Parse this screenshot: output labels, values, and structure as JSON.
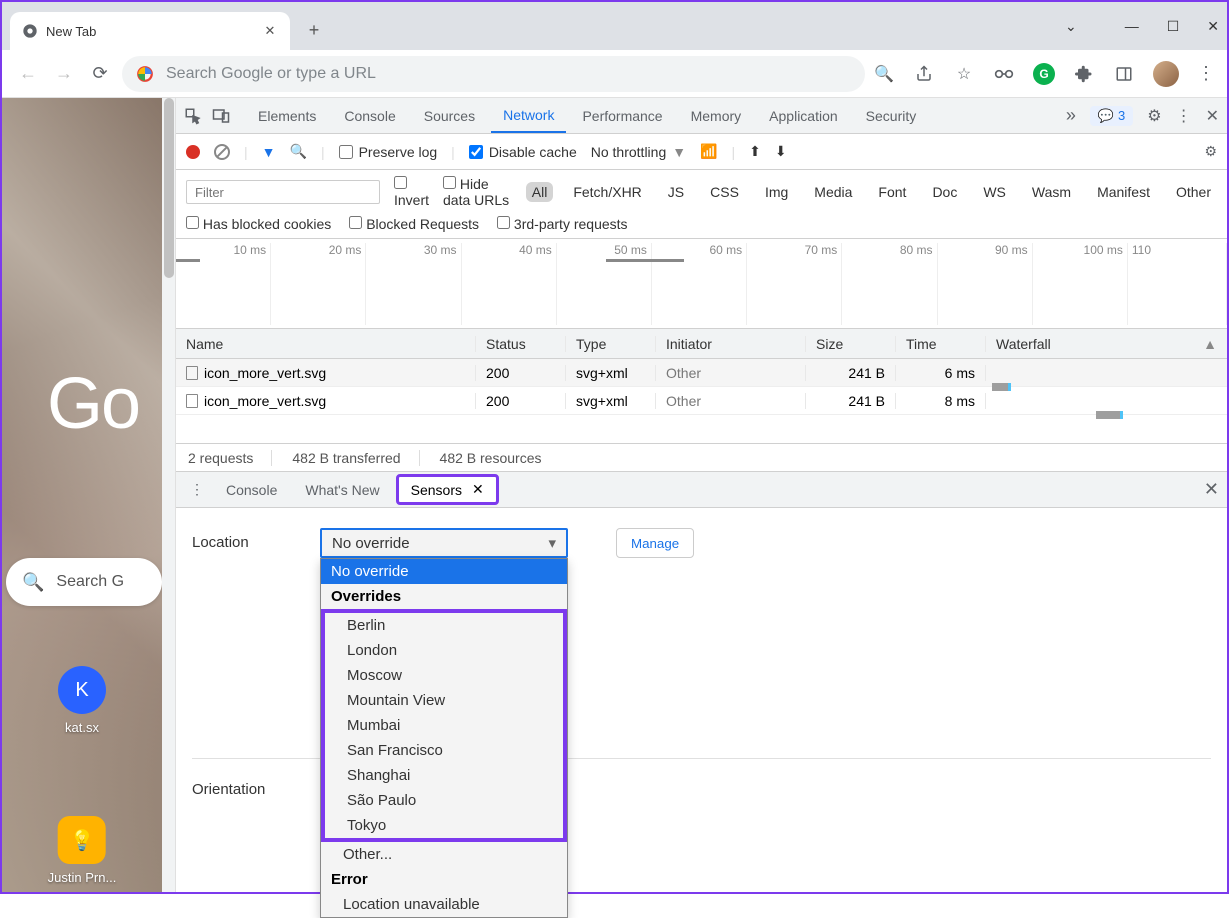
{
  "browser": {
    "tab_title": "New Tab",
    "omnibox_placeholder": "Search Google or type a URL"
  },
  "page": {
    "logo_text": "Go",
    "search_placeholder": "Search G",
    "shortcuts": [
      {
        "letter": "K",
        "label": "kat.sx"
      },
      {
        "letter": "",
        "label": "Justin Prn..."
      }
    ]
  },
  "devtools": {
    "tabs": [
      "Elements",
      "Console",
      "Sources",
      "Network",
      "Performance",
      "Memory",
      "Application",
      "Security"
    ],
    "active_tab": "Network",
    "issues_count": "3",
    "network_toolbar": {
      "preserve_log": "Preserve log",
      "disable_cache": "Disable cache",
      "throttling": "No throttling"
    },
    "filter": {
      "placeholder": "Filter",
      "invert": "Invert",
      "hide_data_urls": "Hide data URLs",
      "types": [
        "All",
        "Fetch/XHR",
        "JS",
        "CSS",
        "Img",
        "Media",
        "Font",
        "Doc",
        "WS",
        "Wasm",
        "Manifest",
        "Other"
      ],
      "active_type": "All",
      "has_blocked_cookies": "Has blocked cookies",
      "blocked_requests": "Blocked Requests",
      "third_party": "3rd-party requests"
    },
    "timeline_ticks": [
      "10 ms",
      "20 ms",
      "30 ms",
      "40 ms",
      "50 ms",
      "60 ms",
      "70 ms",
      "80 ms",
      "90 ms",
      "100 ms",
      "110"
    ],
    "columns": [
      "Name",
      "Status",
      "Type",
      "Initiator",
      "Size",
      "Time",
      "Waterfall"
    ],
    "requests": [
      {
        "name": "icon_more_vert.svg",
        "status": "200",
        "type": "svg+xml",
        "initiator": "Other",
        "size": "241 B",
        "time": "6 ms"
      },
      {
        "name": "icon_more_vert.svg",
        "status": "200",
        "type": "svg+xml",
        "initiator": "Other",
        "size": "241 B",
        "time": "8 ms"
      }
    ],
    "summary": {
      "requests": "2 requests",
      "transferred": "482 B transferred",
      "resources": "482 B resources"
    }
  },
  "drawer": {
    "tabs": [
      "Console",
      "What's New",
      "Sensors"
    ],
    "active": "Sensors",
    "sensors": {
      "location_label": "Location",
      "location_value": "No override",
      "manage": "Manage",
      "orientation_label": "Orientation",
      "dropdown": {
        "no_override": "No override",
        "overrides_header": "Overrides",
        "cities": [
          "Berlin",
          "London",
          "Moscow",
          "Mountain View",
          "Mumbai",
          "San Francisco",
          "Shanghai",
          "São Paulo",
          "Tokyo"
        ],
        "other": "Other...",
        "error_header": "Error",
        "location_unavailable": "Location unavailable"
      }
    }
  }
}
